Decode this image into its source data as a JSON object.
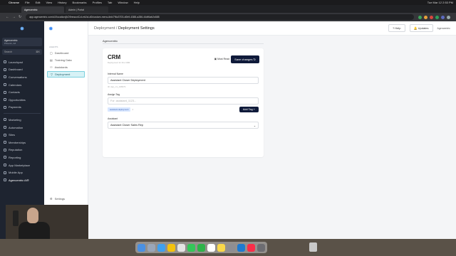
{
  "menubar": {
    "items": [
      "Chrome",
      "File",
      "Edit",
      "View",
      "History",
      "Bookmarks",
      "Profiles",
      "Tab",
      "Window",
      "Help"
    ],
    "clock": "Tue Mar 12  2:53 PM"
  },
  "browser": {
    "tabs": [
      "Agencentric",
      "Admin | Portal"
    ],
    "url": "app.agencentric.com/v2/location/jkO9nrwuxiCzLeb2zLd0/custom-menu-link/7f6c3703-d0b9-4388-a286-44df6ab2c688"
  },
  "sidebar": {
    "account_name": "Agencentric",
    "account_sub": "Phoenix, AZ",
    "search_placeholder": "Search",
    "search_shortcut": "⌘K",
    "items": [
      {
        "label": "Launchpad"
      },
      {
        "label": "Dashboard"
      },
      {
        "label": "Conversations"
      },
      {
        "label": "Calendars"
      },
      {
        "label": "Contacts"
      },
      {
        "label": "Opportunities"
      },
      {
        "label": "Payments"
      },
      {
        "label": "Marketing"
      },
      {
        "label": "Automation"
      },
      {
        "label": "Sites"
      },
      {
        "label": "Memberships"
      },
      {
        "label": "Reputation"
      },
      {
        "label": "Reporting"
      },
      {
        "label": "App Marketplace"
      },
      {
        "label": "Mobile App"
      },
      {
        "label": "Agencentric AI®"
      }
    ]
  },
  "subnav": {
    "section": "AGENTS",
    "items": [
      {
        "label": "Dashboard"
      },
      {
        "label": "Training Data"
      },
      {
        "label": "Assistants"
      },
      {
        "label": "Deployment"
      }
    ],
    "settings_label": "Settings"
  },
  "topbar": {
    "crumb_parent": "Deployment",
    "crumb_sep": " / ",
    "crumb_current": "Deployment Settings",
    "help": "Help",
    "updates": "Updates",
    "brand": "Agencentric"
  },
  "content": {
    "tab_label": "Agencentric",
    "card": {
      "title": "CRM",
      "description": "Deployment for this CRM",
      "must_read": "Must Read",
      "save_button": "Save changes",
      "internal_name_label": "Internal Name",
      "internal_name_value": "Assistant Closer Deployment",
      "internal_name_help": "ID: dep_cm_438373",
      "assign_tag_label": "Assign Tag",
      "assign_tag_placeholder": "For: assistant_1123...",
      "tag_chip": "assistant-deployment",
      "add_tag_button": "Add Tag",
      "assistant_label": "Assistant",
      "assistant_value": "Assistant Closer Sales Rep"
    }
  }
}
